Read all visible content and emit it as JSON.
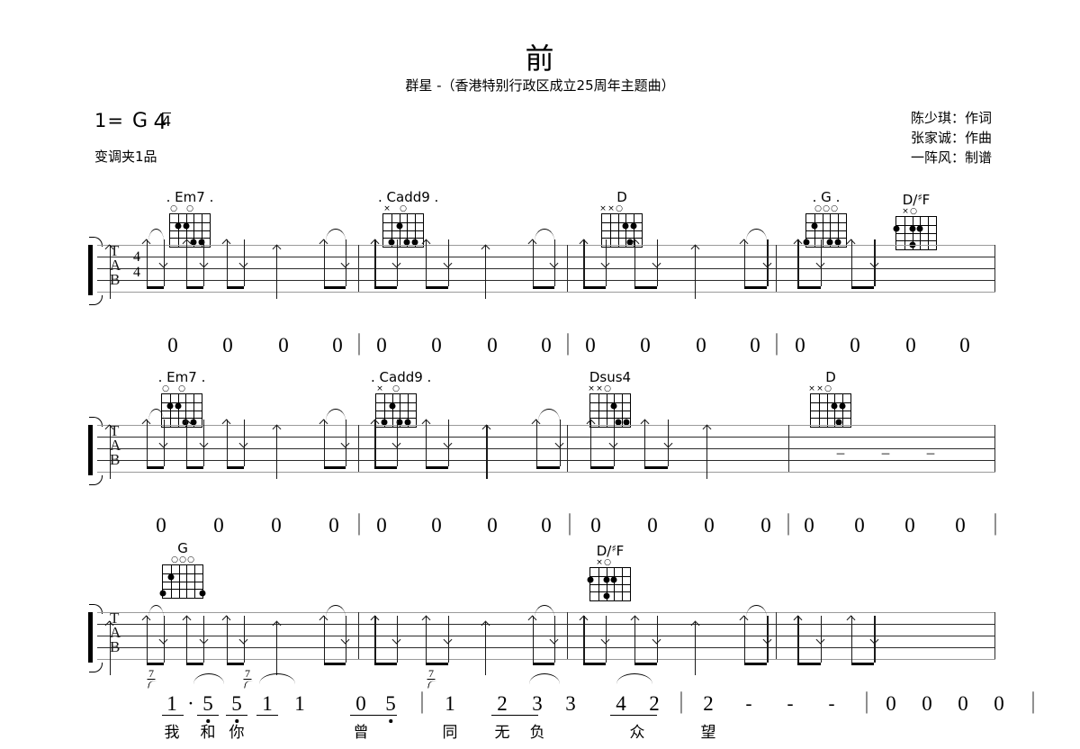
{
  "header": {
    "title": "前",
    "subtitle": "群星 -（香港特别行政区成立25周年主题曲）",
    "key_prefix": "1=",
    "key_note": "G",
    "time_numerator": "4",
    "time_denominator": "4",
    "capo": "变调夹1品",
    "credits": [
      "陈少琪：作词",
      "张家诚：作曲",
      "一阵风：制谱"
    ]
  },
  "staff": {
    "tab_letters": [
      "T",
      "A",
      "B"
    ],
    "time_numerator": "4",
    "time_denominator": "4"
  },
  "chords": {
    "em7": {
      "label": "Em7",
      "display": ". Em7 ."
    },
    "cadd9": {
      "label": "Cadd9",
      "display": ". Cadd9 ."
    },
    "d": {
      "label": "D",
      "display": "D"
    },
    "g": {
      "label": "G",
      "display": ". G ."
    },
    "g_plain": {
      "label": "G",
      "display": "G"
    },
    "dsharpf": {
      "label": "D/#F",
      "display": "D/",
      "accidental": "♯",
      "bass": "F"
    },
    "dsus4": {
      "label": "Dsus4",
      "display": "Dsus4"
    }
  },
  "systems": [
    {
      "id": "system-1",
      "chord_sequence": [
        "Em7",
        "Cadd9",
        "D",
        "G",
        "D/#F"
      ],
      "measures": [
        {
          "notes": [
            "0",
            "0",
            "0",
            "0"
          ]
        },
        {
          "notes": [
            "0",
            "0",
            "0",
            "0"
          ]
        },
        {
          "notes": [
            "0",
            "0",
            "0",
            "0"
          ]
        },
        {
          "notes": [
            "0",
            "0",
            "0",
            "0"
          ]
        }
      ]
    },
    {
      "id": "system-2",
      "chord_sequence": [
        "Em7",
        "Cadd9",
        "Dsus4",
        "D"
      ],
      "measures": [
        {
          "notes": [
            "0",
            "0",
            "0",
            "0"
          ]
        },
        {
          "notes": [
            "0",
            "0",
            "0",
            "0"
          ]
        },
        {
          "notes": [
            "0",
            "0",
            "0",
            "0"
          ]
        },
        {
          "notes": [
            "0",
            "0",
            "0",
            "0"
          ]
        }
      ]
    },
    {
      "id": "system-3",
      "chord_sequence": [
        "G",
        "D/#F"
      ],
      "measures": [
        {
          "notes": [
            "1",
            "5",
            "5",
            "1",
            "1"
          ]
        },
        {
          "notes": [
            "0",
            "5"
          ]
        },
        {
          "notes": [
            "1",
            "2",
            "3",
            "3",
            "4",
            "2"
          ]
        },
        {
          "notes": [
            "2",
            "-",
            "-",
            "-"
          ]
        },
        {
          "notes": [
            "0",
            "0",
            "0",
            "0"
          ]
        }
      ],
      "lyrics": [
        "我",
        "和",
        "你",
        "曾",
        "同",
        "无",
        "负",
        "众",
        "望"
      ],
      "grace_notes": [
        "7",
        "7",
        "7"
      ]
    }
  ],
  "notation_tokens": {
    "system1_row": [
      "0",
      "0",
      "0",
      "0",
      "|",
      "0",
      "0",
      "0",
      "0",
      "|",
      "0",
      "0",
      "0",
      "0",
      "|",
      "0",
      "0",
      "0",
      "0"
    ],
    "system2_row": [
      "0",
      "0",
      "0",
      "0",
      "|",
      "0",
      "0",
      "0",
      "0",
      "|",
      "0",
      "0",
      "0",
      "0",
      "|",
      "0",
      "0",
      "0",
      "0",
      "|"
    ],
    "system3_row": [
      "1",
      "·",
      "5",
      "5",
      "1",
      "1",
      "0",
      "5",
      "|",
      "1",
      "2",
      "3",
      "3",
      "4",
      "2",
      "|",
      "2",
      "-",
      "-",
      "-",
      "|",
      "0",
      "0",
      "0",
      "0",
      "|"
    ]
  }
}
